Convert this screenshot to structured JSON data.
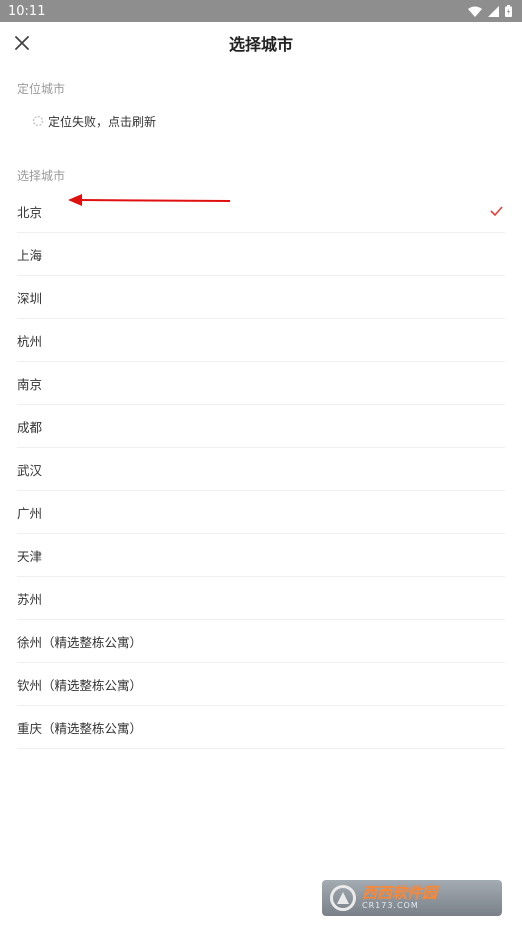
{
  "status_bar": {
    "time": "10:11"
  },
  "header": {
    "title": "选择城市"
  },
  "location_section": {
    "label": "定位城市",
    "status_text": "定位失败，点击刷新"
  },
  "city_section": {
    "label": "选择城市"
  },
  "cities": [
    {
      "name": "北京",
      "selected": true
    },
    {
      "name": "上海",
      "selected": false
    },
    {
      "name": "深圳",
      "selected": false
    },
    {
      "name": "杭州",
      "selected": false
    },
    {
      "name": "南京",
      "selected": false
    },
    {
      "name": "成都",
      "selected": false
    },
    {
      "name": "武汉",
      "selected": false
    },
    {
      "name": "广州",
      "selected": false
    },
    {
      "name": "天津",
      "selected": false
    },
    {
      "name": "苏州",
      "selected": false
    },
    {
      "name": "徐州（精选整栋公寓）",
      "selected": false
    },
    {
      "name": "钦州（精选整栋公寓）",
      "selected": false
    },
    {
      "name": "重庆（精选整栋公寓）",
      "selected": false
    }
  ],
  "watermark": {
    "brand": "西西软件园",
    "domain": "CR173.COM"
  },
  "colors": {
    "accent": "#e8403a",
    "annotation": "#e01010"
  }
}
